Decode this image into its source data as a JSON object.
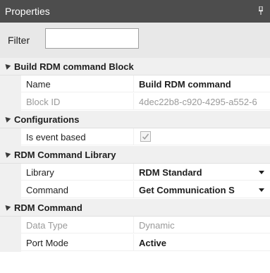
{
  "panel": {
    "title": "Properties"
  },
  "filter": {
    "label": "Filter",
    "value": ""
  },
  "categories": [
    {
      "title": "Build RDM command Block",
      "rows": [
        {
          "name": "Name",
          "value": "Build RDM command"
        },
        {
          "name": "Block ID",
          "value": "4dec22b8-c920-4295-a552-6"
        }
      ]
    },
    {
      "title": "Configurations",
      "rows": [
        {
          "name": "Is event based",
          "checked": true
        }
      ]
    },
    {
      "title": "RDM Command Library",
      "rows": [
        {
          "name": "Library",
          "value": "RDM Standard"
        },
        {
          "name": "Command",
          "value": "Get Communication S"
        }
      ]
    },
    {
      "title": "RDM Command",
      "rows": [
        {
          "name": "Data Type",
          "value": "Dynamic"
        },
        {
          "name": "Port Mode",
          "value": "Active"
        }
      ]
    }
  ]
}
